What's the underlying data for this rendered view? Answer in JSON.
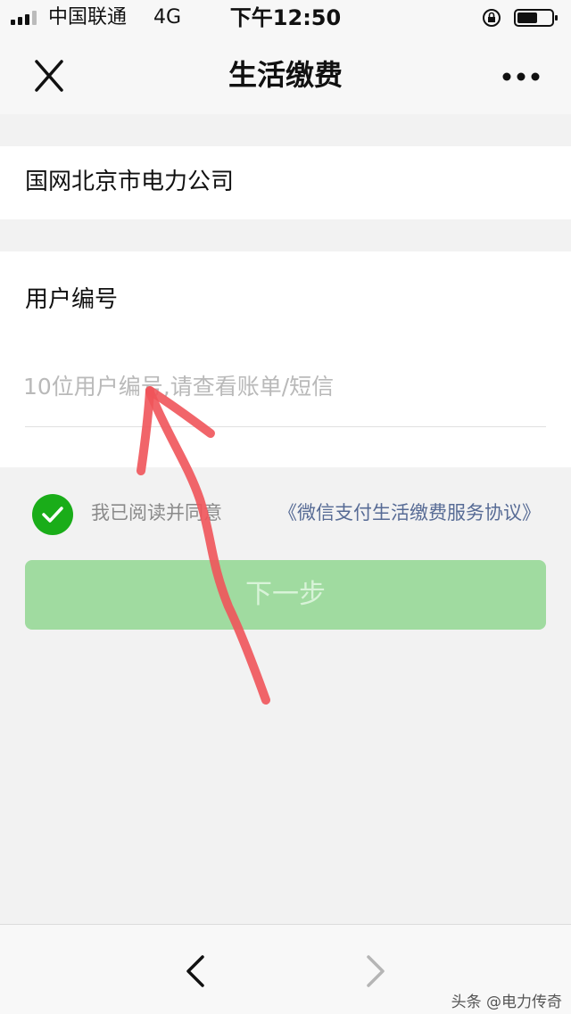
{
  "status_bar": {
    "carrier": "中国联通",
    "network": "4G",
    "time": "下午12:50",
    "signal_icon": "signal-bars-icon",
    "lock_icon": "orientation-lock-icon",
    "battery_icon": "battery-icon"
  },
  "nav": {
    "title": "生活缴费",
    "close_icon": "close-icon",
    "more_icon": "more-dots-icon"
  },
  "form": {
    "company": "国网北京市电力公司",
    "account_label": "用户编号",
    "account_value": "",
    "account_placeholder": "10位用户编号,请查看账单/短信",
    "agreement_checked": true,
    "agreement_text": "我已阅读并同意",
    "agreement_link": "《微信支付生活缴费服务协议》",
    "next_button": "下一步"
  },
  "bottom_bar": {
    "back_icon": "chevron-left-icon",
    "forward_icon": "chevron-right-icon",
    "watermark": "头条 @电力传奇"
  },
  "colors": {
    "accent_green": "#1aad19",
    "button_disabled_green": "#a0dba0",
    "link_blue": "#576b95",
    "annotation_red": "#f0545a"
  }
}
